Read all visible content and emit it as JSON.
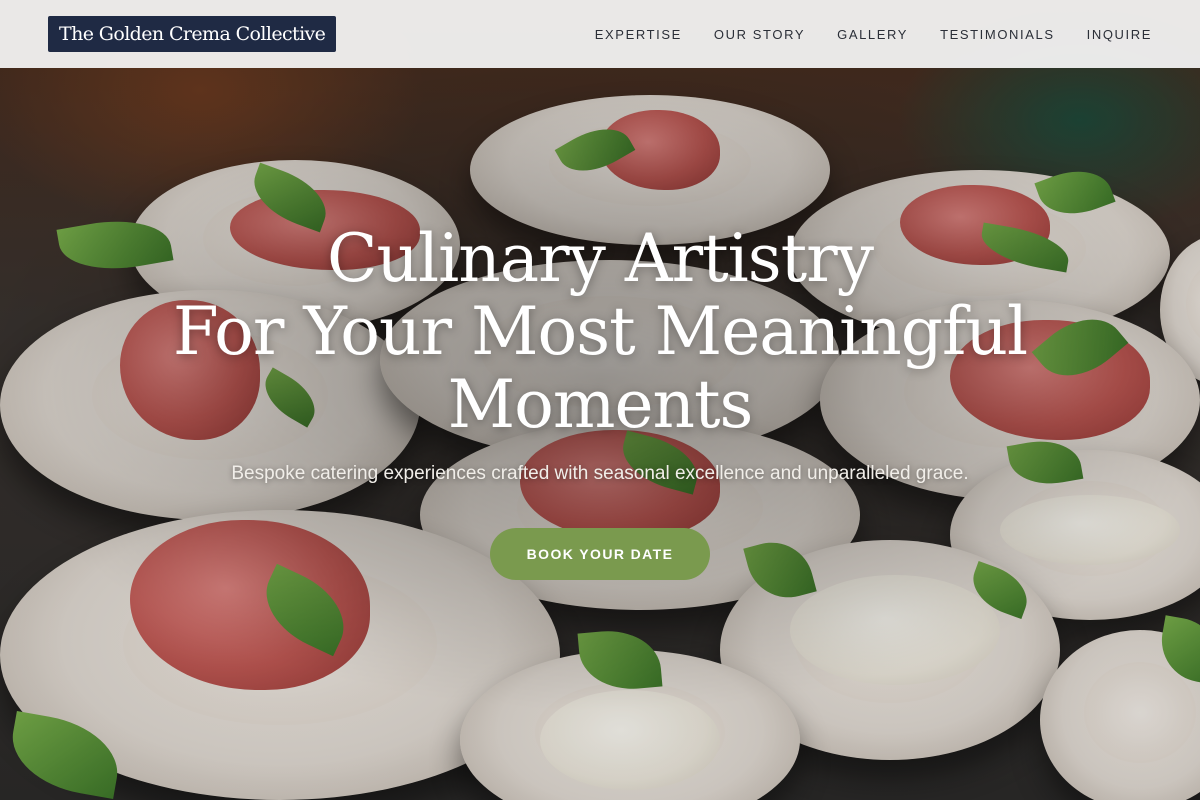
{
  "brand": {
    "name": "The Golden Crema Collective"
  },
  "nav": {
    "items": [
      {
        "label": "EXPERTISE"
      },
      {
        "label": "OUR STORY"
      },
      {
        "label": "GALLERY"
      },
      {
        "label": "TESTIMONIALS"
      },
      {
        "label": "INQUIRE"
      }
    ]
  },
  "hero": {
    "headline_line1": "Culinary Artistry",
    "headline_line2": "For Your Most Meaningful",
    "headline_line3": "Moments",
    "subtitle": "Bespoke catering experiences crafted with seasonal excellence and unparalleled grace.",
    "cta_label": "BOOK YOUR DATE"
  },
  "colors": {
    "logo_bg": "#1f2a44",
    "cta_bg": "#7a9a4e",
    "header_bg": "#f4f4f4",
    "nav_text": "#2b2f38"
  }
}
